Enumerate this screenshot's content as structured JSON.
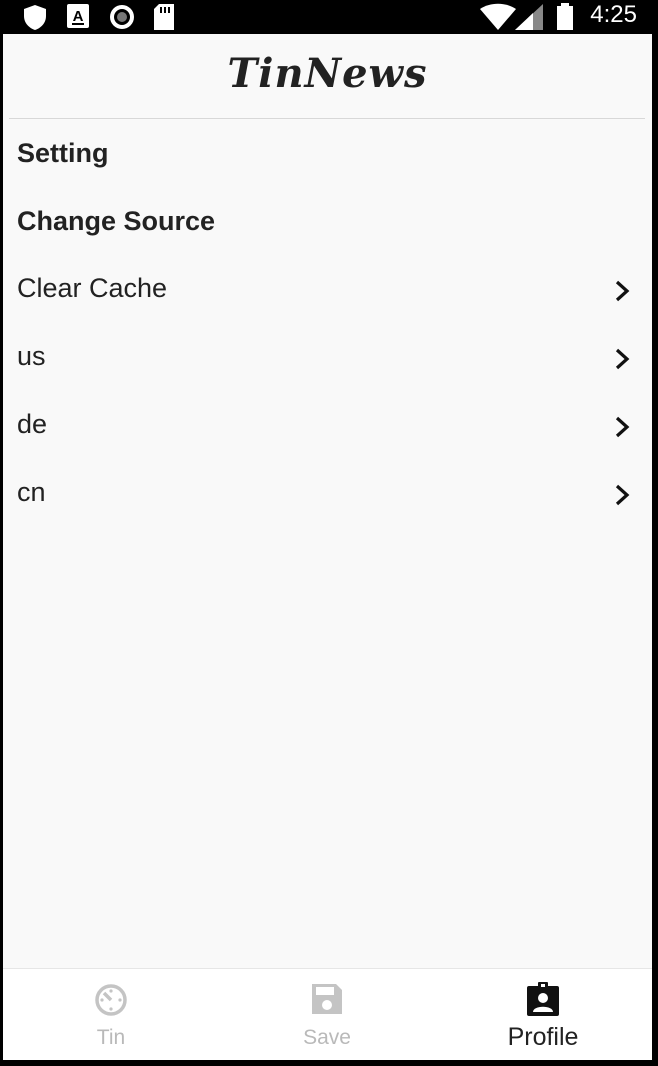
{
  "status_bar": {
    "time": "4:25",
    "icons": [
      "shield-icon",
      "a-notification-icon",
      "record-icon",
      "sd-card-icon",
      "wifi-icon",
      "signal-icon",
      "battery-icon"
    ]
  },
  "header": {
    "title": "TinNews"
  },
  "sections": {
    "setting": "Setting",
    "change_source": "Change Source"
  },
  "menu": [
    {
      "label": "Clear Cache"
    },
    {
      "label": "us"
    },
    {
      "label": "de"
    },
    {
      "label": "cn"
    }
  ],
  "bottom_nav": {
    "items": [
      {
        "label": "Tin",
        "icon": "timer-icon",
        "active": false
      },
      {
        "label": "Save",
        "icon": "save-icon",
        "active": false
      },
      {
        "label": "Profile",
        "icon": "profile-badge-icon",
        "active": true
      }
    ],
    "active_color": "#222222",
    "inactive_color": "#b9b9b9"
  }
}
